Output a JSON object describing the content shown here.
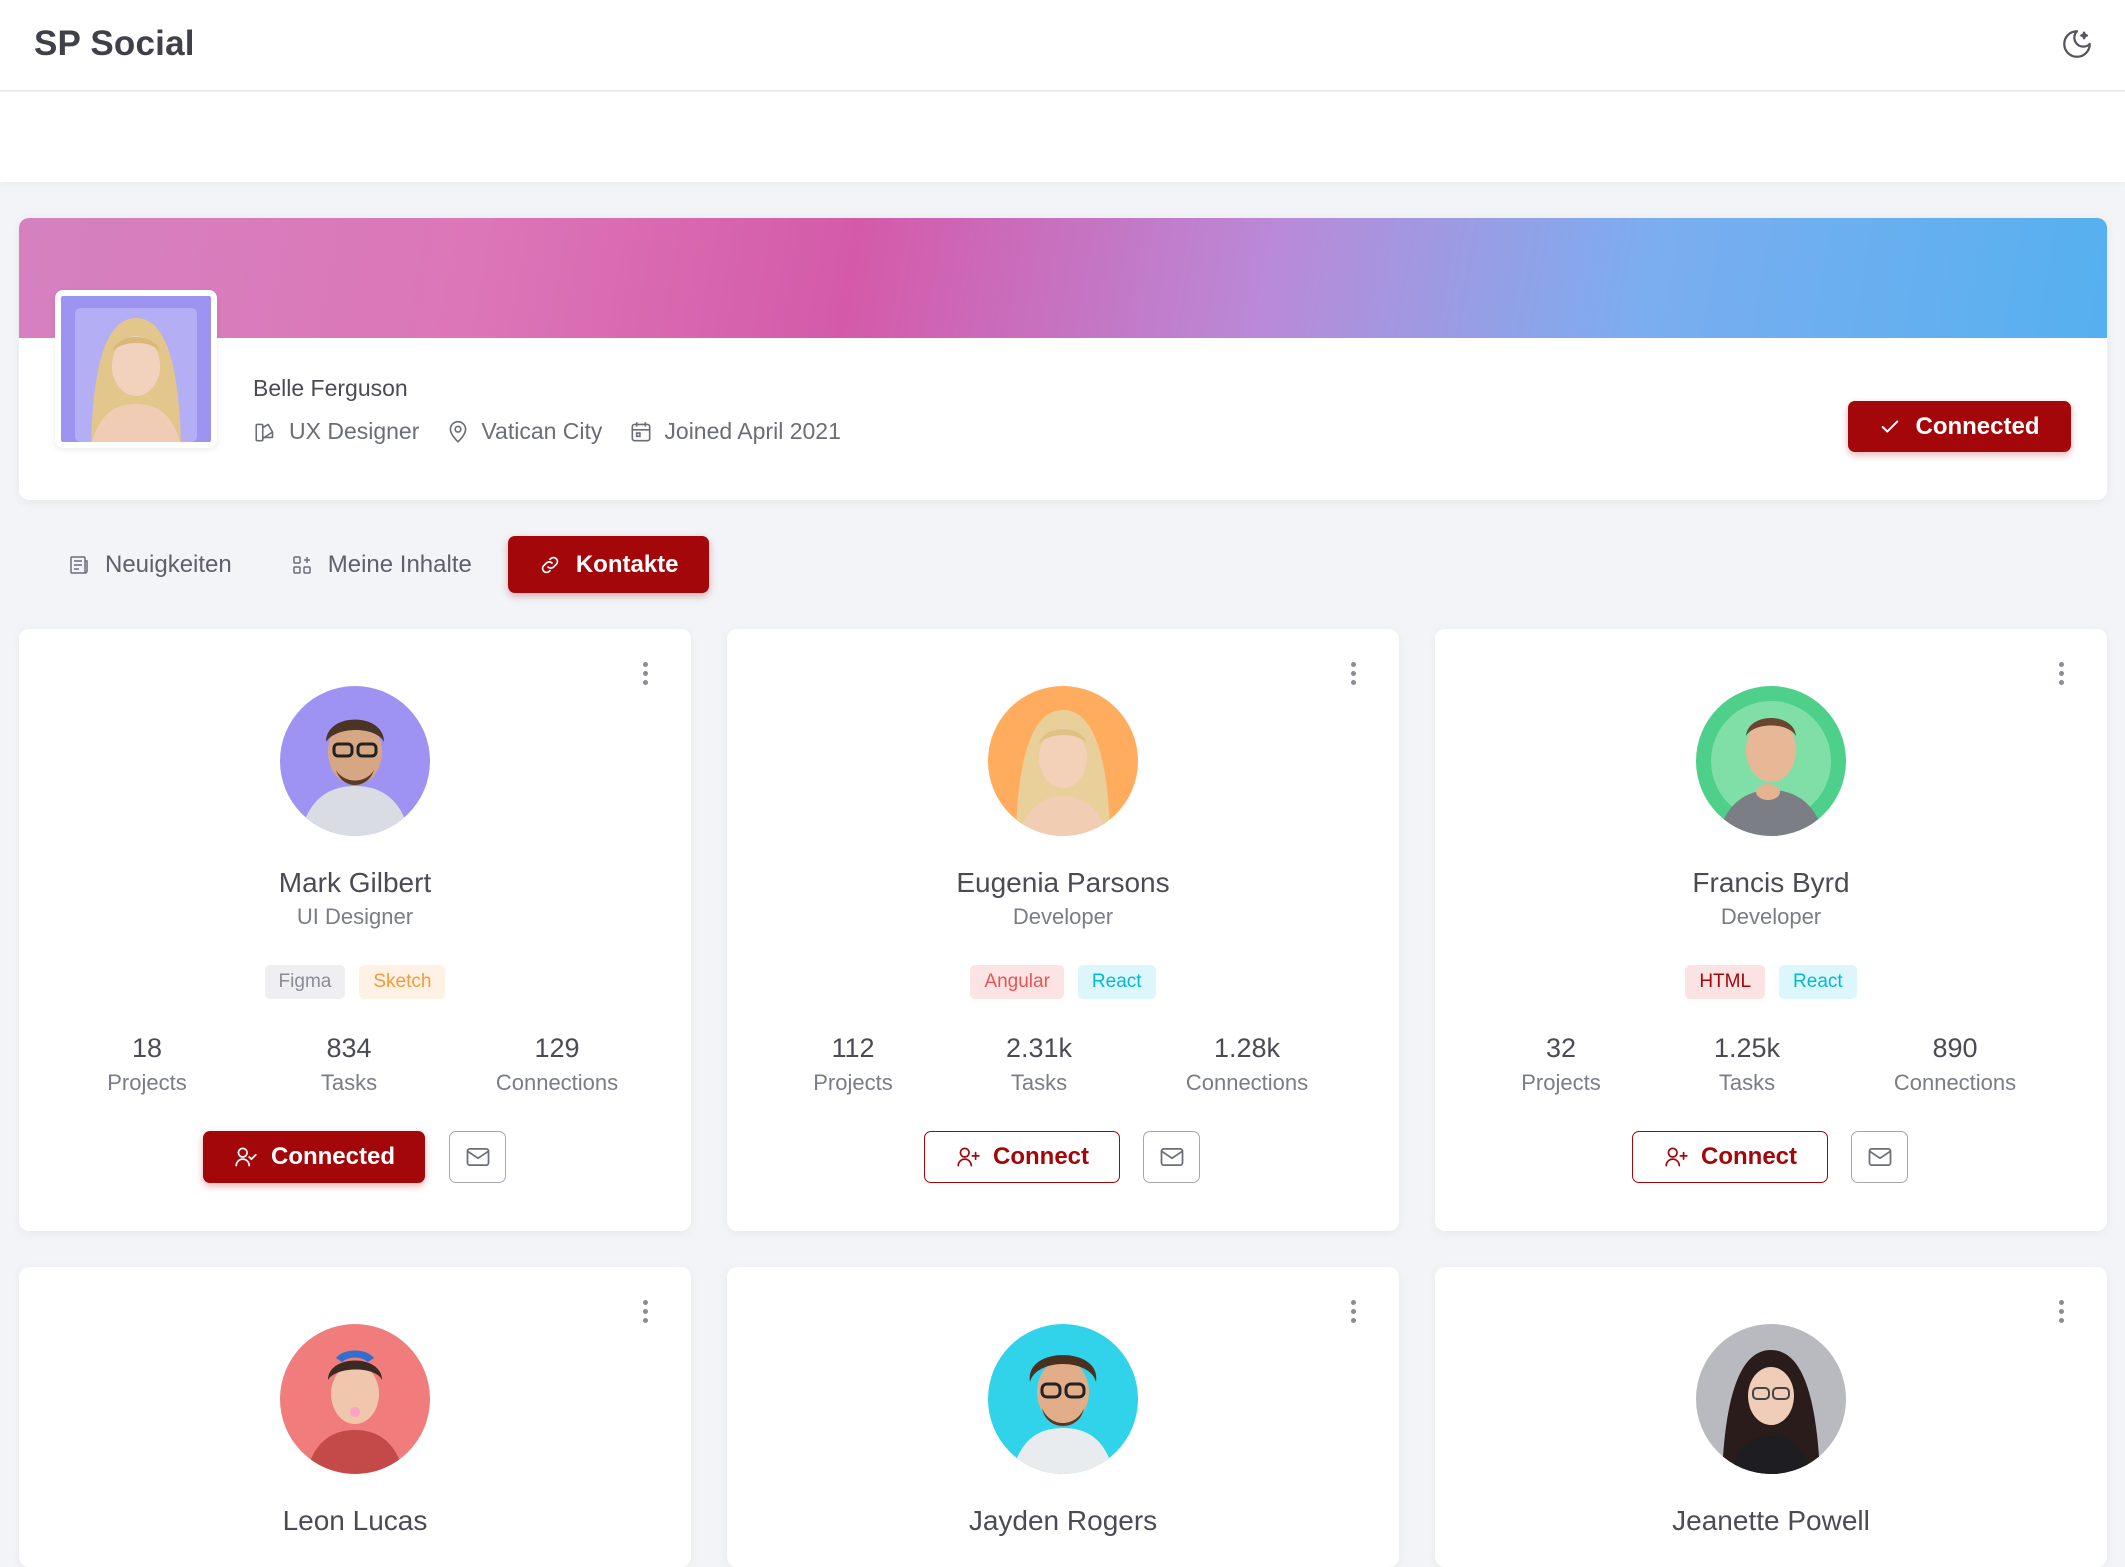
{
  "app": {
    "title": "SP Social"
  },
  "profile": {
    "name": "Belle Ferguson",
    "role": "UX Designer",
    "location": "Vatican City",
    "joined": "Joined April 2021",
    "button_label": "Connected"
  },
  "tabs": [
    {
      "label": "Neuigkeiten",
      "icon": "news-icon",
      "active": false
    },
    {
      "label": "Meine Inhalte",
      "icon": "grid-icon",
      "active": false
    },
    {
      "label": "Kontakte",
      "icon": "link-icon",
      "active": true
    }
  ],
  "contacts": [
    {
      "name": "Mark Gilbert",
      "role": "UI Designer",
      "tags": [
        {
          "label": "Figma",
          "bg": "#efeff1",
          "fg": "#8a8c96"
        },
        {
          "label": "Sketch",
          "bg": "#fff1e3",
          "fg": "#f49a3c"
        }
      ],
      "stats": {
        "projects": "18",
        "projects_label": "Projects",
        "tasks": "834",
        "tasks_label": "Tasks",
        "connections": "129",
        "connections_label": "Connections"
      },
      "button_label": "Connected",
      "connected": true,
      "avatar_bg": "#9e93f2"
    },
    {
      "name": "Eugenia Parsons",
      "role": "Developer",
      "tags": [
        {
          "label": "Angular",
          "bg": "#fde4e4",
          "fg": "#ea5455"
        },
        {
          "label": "React",
          "bg": "#ddf6fb",
          "fg": "#00bad1"
        }
      ],
      "stats": {
        "projects": "112",
        "projects_label": "Projects",
        "tasks": "2.31k",
        "tasks_label": "Tasks",
        "connections": "1.28k",
        "connections_label": "Connections"
      },
      "button_label": "Connect",
      "connected": false,
      "avatar_bg": "#ffac5f"
    },
    {
      "name": "Francis Byrd",
      "role": "Developer",
      "tags": [
        {
          "label": "HTML",
          "bg": "#fbe3e4",
          "fg": "#a3070a"
        },
        {
          "label": "React",
          "bg": "#ddf6fb",
          "fg": "#00bad1"
        }
      ],
      "stats": {
        "projects": "32",
        "projects_label": "Projects",
        "tasks": "1.25k",
        "tasks_label": "Tasks",
        "connections": "890",
        "connections_label": "Connections"
      },
      "button_label": "Connect",
      "connected": false,
      "avatar_bg": "#4fd08a"
    },
    {
      "name": "Leon Lucas",
      "avatar_bg": "#f07c7c"
    },
    {
      "name": "Jayden Rogers",
      "avatar_bg": "#30d3ea"
    },
    {
      "name": "Jeanette Powell",
      "avatar_bg": "#b9bac0"
    }
  ],
  "colors": {
    "primary": "#a3070a",
    "background": "#f2f4f8"
  }
}
